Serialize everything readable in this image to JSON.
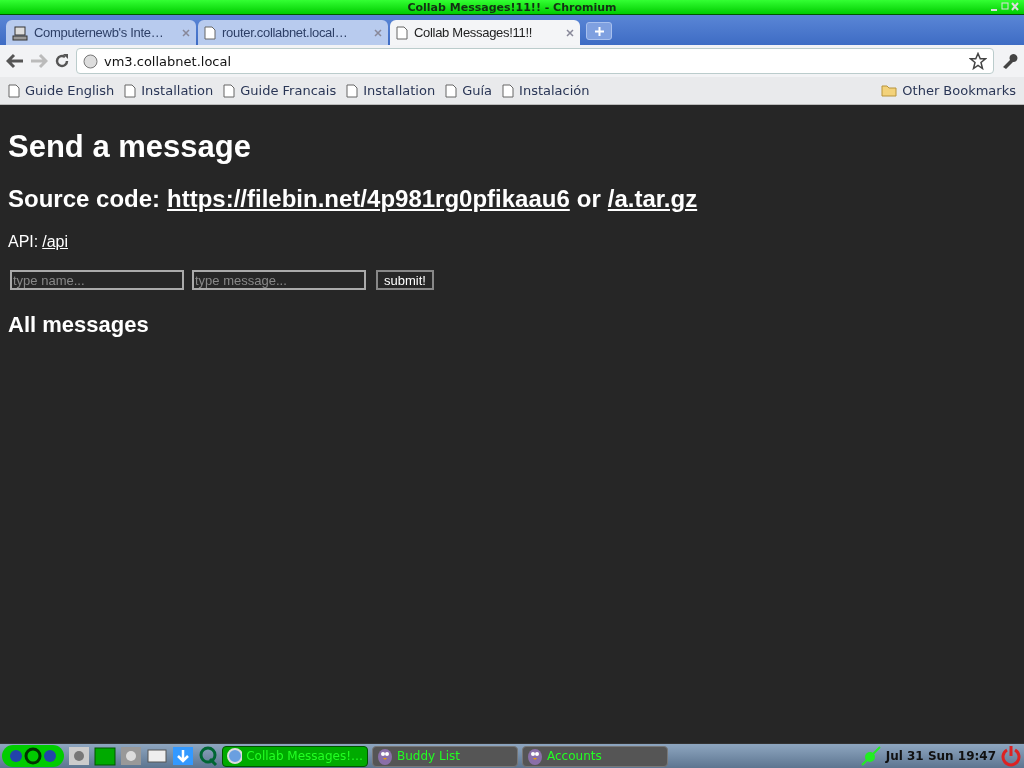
{
  "window": {
    "title": "Collab Messages!11!! - Chromium"
  },
  "tabs": [
    {
      "label": "Computernewb's Inte…",
      "kind": "computer",
      "selected": false
    },
    {
      "label": "router.collabnet.local…",
      "kind": "page",
      "selected": false
    },
    {
      "label": "Collab Messages!11!!",
      "kind": "page",
      "selected": true
    }
  ],
  "address_bar": {
    "value": "vm3.collabnet.local"
  },
  "bookmarks": [
    "Guide English",
    "Installation",
    "Guide Francais",
    "Installation",
    "Guía",
    "Instalación"
  ],
  "other_bookmarks": "Other Bookmarks",
  "page": {
    "heading": "Send a message",
    "source_label": "Source code:",
    "source_link": "https://filebin.net/4p981rg0pfikaau6",
    "source_or": "or",
    "source_link_2": "/a.tar.gz",
    "api_label": "API:",
    "api_link": "/api",
    "name_placeholder": "type name...",
    "message_placeholder": "type message...",
    "submit": "submit!",
    "messages_heading": "All messages"
  },
  "taskbar": {
    "tasks": [
      {
        "label": "Collab Messages!…",
        "kind": "browser",
        "selected": true
      },
      {
        "label": "Buddy List",
        "kind": "bird",
        "selected": false
      },
      {
        "label": "Accounts",
        "kind": "bird",
        "selected": false
      }
    ],
    "clock": "Jul 31 Sun 19:47"
  }
}
